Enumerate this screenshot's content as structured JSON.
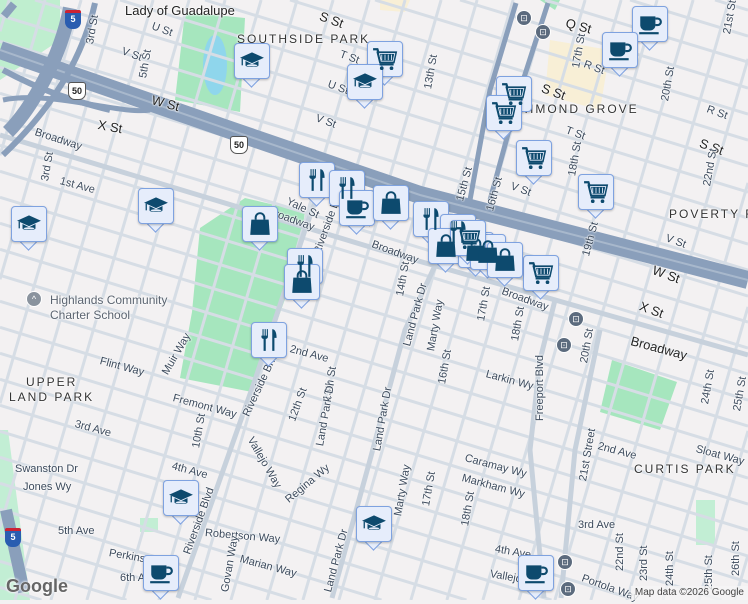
{
  "map": {
    "attribution": "Map data ©2026 Google",
    "logo": "Google",
    "colors": {
      "marker_bg": "#e6edfb",
      "marker_border": "#7ea2e0",
      "icon": "#0d4a6e",
      "park": "#a6e6be",
      "freeway": "#8a9fbb",
      "land": "#f3f1f2"
    },
    "shields": [
      "5",
      "50",
      "50",
      "5"
    ],
    "labels": [
      "Lady of Guadalupe",
      "U St",
      "V St",
      "3rd St",
      "5th St",
      "W St",
      "X St",
      "Broadway",
      "3rd St",
      "1st Ave",
      "SOUTHSIDE PARK",
      "T St",
      "U St",
      "V St",
      "Yale St",
      "Broadway",
      "Riverside Blvd",
      "Broadway",
      "13th St",
      "15th St",
      "16th St",
      "S St",
      "Q St",
      "17th St",
      "R St",
      "RICHMOND GROVE",
      "T St",
      "18th St",
      "V St",
      "20th St",
      "R St",
      "S St",
      "22nd St",
      "POVERTY R",
      "V St",
      "W St",
      "19th St",
      "X St",
      "21st St",
      "Broadway",
      "S St",
      "14th St",
      "Land Park Dr",
      "Marty Way",
      "16th St",
      "17th St",
      "18th St",
      "Larkin Wy",
      "Freeport Blvd",
      "20th St",
      "Broadway",
      "21st Street",
      "2nd Ave",
      "CURTIS PARK",
      "Sloat Way",
      "24th St",
      "25th St",
      "Caramay Wy",
      "Markham Wy",
      "17th St",
      "18th St",
      "Marty Way",
      "3rd Ave",
      "4th Ave",
      "Vallejo Way",
      "Portola Way",
      "22nd St",
      "23rd St",
      "24th St",
      "25th St",
      "26th St",
      "Land Park Dr",
      "Land Park Dr",
      "Highlands Community",
      "Charter School",
      "Flint Way",
      "UPPER",
      "LAND PARK",
      "Muir Way",
      "2nd Ave",
      "Fremont Way",
      "Riverside Blvd",
      "12th St",
      "13th St",
      "3rd Ave",
      "10th St",
      "Vallejo Way",
      "4th Ave",
      "Swanston Dr",
      "Jones Wy",
      "Regina Wy",
      "Robertson Way",
      "5th Ave",
      "Perkins Way",
      "Marian Way",
      "Govan Way",
      "6th Ave",
      "Riverside Blvd",
      "Land Park Dr",
      "W St"
    ],
    "markers": [
      {
        "type": "cafe",
        "name": "cafe"
      },
      {
        "type": "cafe",
        "name": "cafe"
      },
      {
        "type": "cart",
        "name": "grocery"
      },
      {
        "type": "school",
        "name": "school"
      },
      {
        "type": "school",
        "name": "school"
      },
      {
        "type": "cart",
        "name": "grocery"
      },
      {
        "type": "cart",
        "name": "grocery"
      },
      {
        "type": "cart",
        "name": "grocery"
      },
      {
        "type": "cart",
        "name": "grocery"
      },
      {
        "type": "school",
        "name": "school"
      },
      {
        "type": "school",
        "name": "school"
      },
      {
        "type": "bag",
        "name": "shop"
      },
      {
        "type": "restaurant",
        "name": "restaurant"
      },
      {
        "type": "restaurant",
        "name": "restaurant"
      },
      {
        "type": "cafe",
        "name": "cafe"
      },
      {
        "type": "bag",
        "name": "shop"
      },
      {
        "type": "restaurant",
        "name": "restaurant"
      },
      {
        "type": "restaurant",
        "name": "restaurant"
      },
      {
        "type": "bag",
        "name": "shop"
      },
      {
        "type": "bag",
        "name": "shop"
      },
      {
        "type": "bag",
        "name": "shop"
      },
      {
        "type": "cart",
        "name": "grocery"
      },
      {
        "type": "restaurant",
        "name": "restaurant"
      },
      {
        "type": "bag",
        "name": "shop"
      },
      {
        "type": "cart",
        "name": "grocery"
      },
      {
        "type": "restaurant",
        "name": "restaurant"
      },
      {
        "type": "school",
        "name": "school"
      },
      {
        "type": "school",
        "name": "school"
      },
      {
        "type": "cafe",
        "name": "cafe"
      },
      {
        "type": "cafe",
        "name": "cafe"
      }
    ],
    "transit_stops": 6
  }
}
